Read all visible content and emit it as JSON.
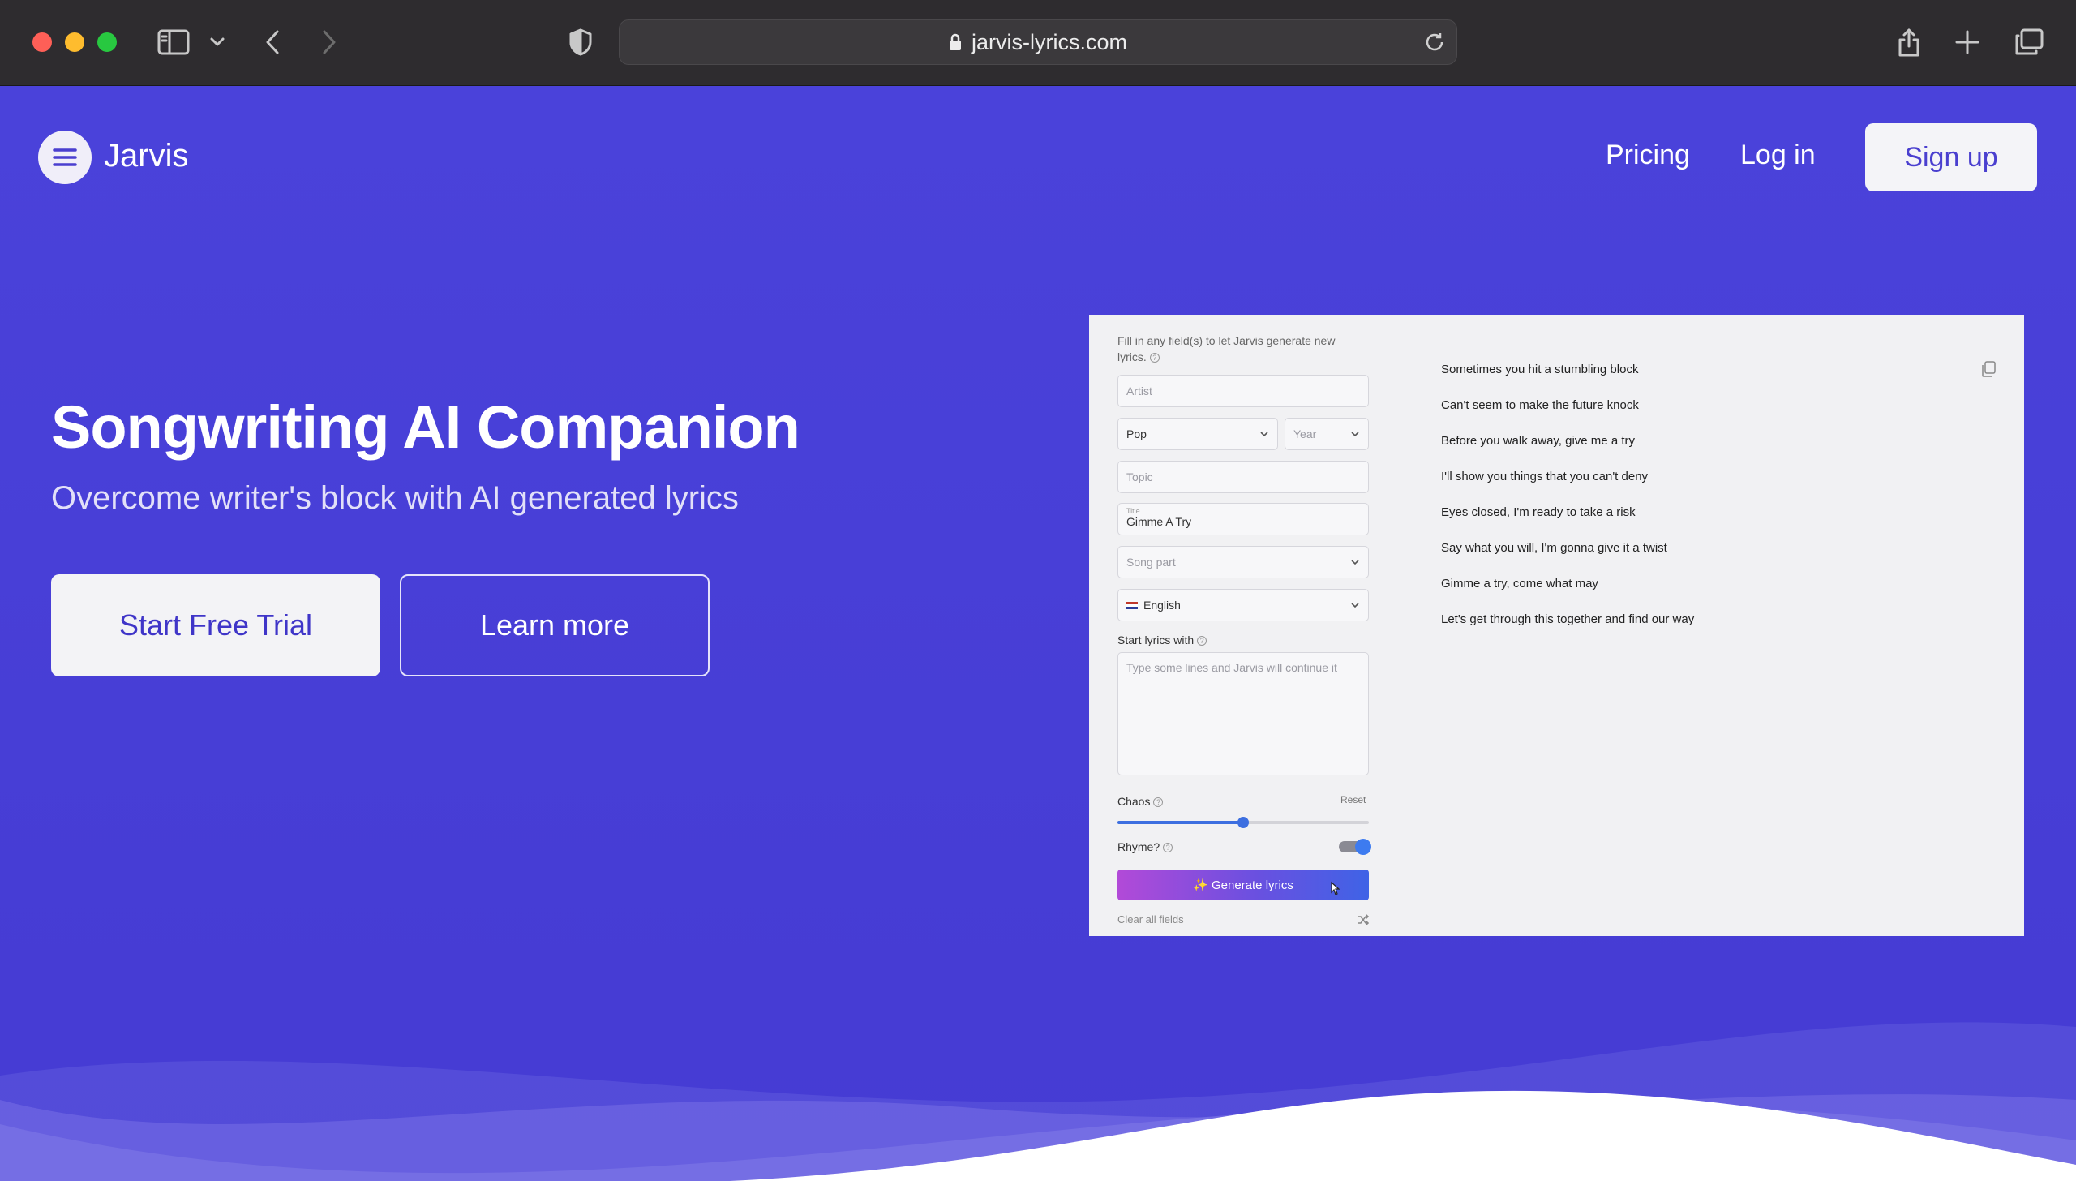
{
  "browser": {
    "url": "jarvis-lyrics.com"
  },
  "nav": {
    "brand": "Jarvis",
    "links": [
      {
        "label": "Pricing"
      },
      {
        "label": "Log in"
      }
    ],
    "signup_label": "Sign up"
  },
  "hero": {
    "title": "Songwriting AI Companion",
    "subtitle": "Overcome writer's block with AI generated lyrics",
    "primary_cta": "Start Free Trial",
    "secondary_cta": "Learn more"
  },
  "app": {
    "hint": "Fill in any field(s) to let Jarvis generate new lyrics.",
    "artist_placeholder": "Artist",
    "genre_value": "Pop",
    "year_placeholder": "Year",
    "topic_placeholder": "Topic",
    "title_label": "Title",
    "title_value": "Gimme A Try",
    "song_part_placeholder": "Song part",
    "language_value": "English",
    "start_lyrics_label": "Start lyrics with",
    "start_lyrics_placeholder": "Type some lines and Jarvis will continue it",
    "chaos_label": "Chaos",
    "chaos_level": 0.5,
    "reset_label": "Reset",
    "rhyme_label": "Rhyme?",
    "rhyme_on": true,
    "generate_label": "✨ Generate lyrics",
    "clear_label": "Clear all fields",
    "lyrics": [
      "Sometimes you hit a stumbling block",
      "Can't seem to make the future knock",
      "Before you walk away, give me a try",
      "I'll show you things that you can't deny",
      "Eyes closed, I'm ready to take a risk",
      "Say what you will, I'm gonna give it a twist",
      "Gimme a try, come what may",
      "Let's get through this together and find our way"
    ]
  },
  "colors": {
    "page_bg": "#4840d8",
    "accent": "#3d6fe0",
    "button_text": "#3f35c8"
  }
}
